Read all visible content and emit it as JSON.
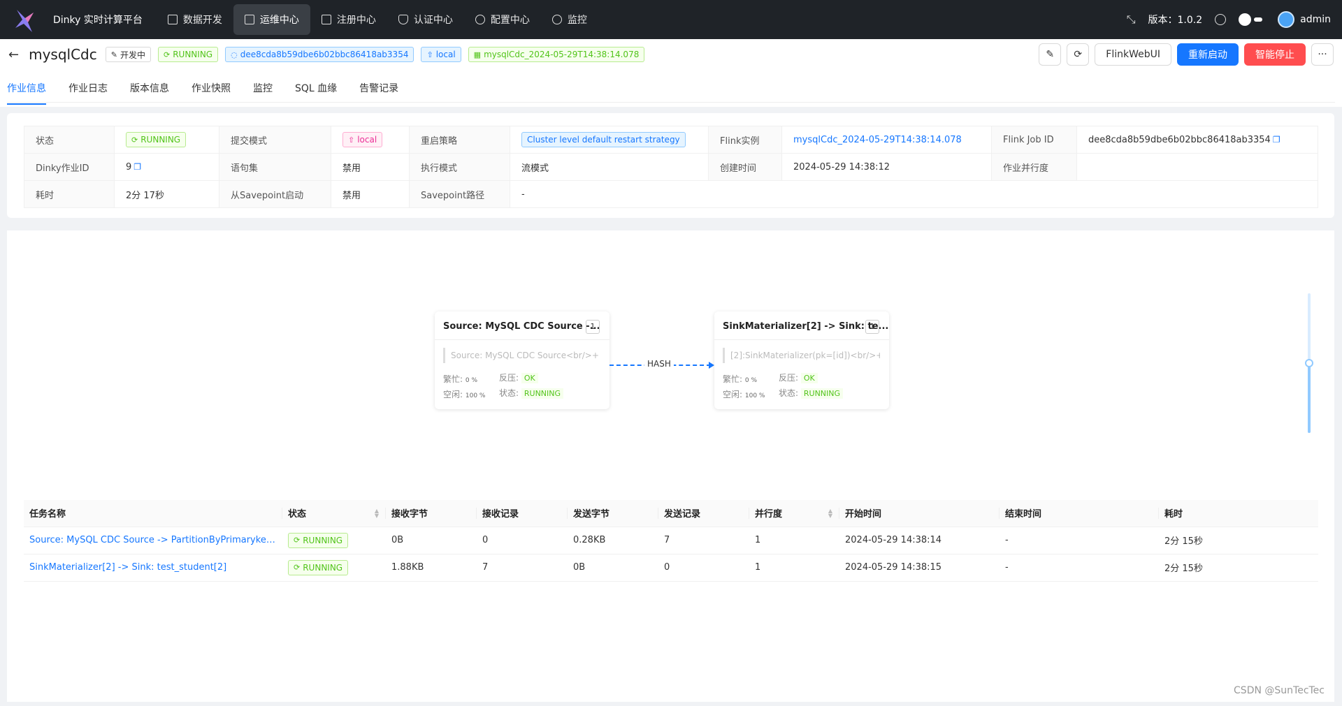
{
  "nav": {
    "brand": "Dinky 实时计算平台",
    "items": [
      "数据开发",
      "运维中心",
      "注册中心",
      "认证中心",
      "配置中心",
      "监控"
    ],
    "version": "版本：1.0.2",
    "user": "admin"
  },
  "header": {
    "job_name": "mysqlCdc",
    "dev_tag": "开发中",
    "status_tag": "RUNNING",
    "job_id_tag": "dee8cda8b59dbe6b02bbc86418ab3354",
    "env_tag": "local",
    "instance_tag": "mysqlCdc_2024-05-29T14:38:14.078",
    "btn_flinkweb": "FlinkWebUI",
    "btn_restart": "重新启动",
    "btn_stop": "智能停止",
    "btn_more": "···"
  },
  "tabs": [
    "作业信息",
    "作业日志",
    "版本信息",
    "作业快照",
    "监控",
    "SQL 血缘",
    "告警记录"
  ],
  "info": {
    "l_status": "状态",
    "v_status": "RUNNING",
    "l_submit": "提交模式",
    "v_submit": "local",
    "l_restart": "重启策略",
    "v_restart": "Cluster level default restart strategy",
    "l_instance": "Flink实例",
    "v_instance": "mysqlCdc_2024-05-29T14:38:14.078",
    "l_jobid": "Flink Job ID",
    "v_jobid": "dee8cda8b59dbe6b02bbc86418ab3354",
    "l_dinkyid": "Dinky作业ID",
    "v_dinkyid": "9",
    "l_stmt": "语句集",
    "v_stmt": "禁用",
    "l_exec": "执行模式",
    "v_exec": "流模式",
    "l_created": "创建时间",
    "v_created": "2024-05-29 14:38:12",
    "l_parallel": "作业并行度",
    "v_parallel": "",
    "l_duration": "耗时",
    "v_duration": "2分 17秒",
    "l_fromsp": "从Savepoint启动",
    "v_fromsp": "禁用",
    "l_sppath": "Savepoint路径",
    "v_sppath": "-"
  },
  "graph": {
    "nodes": [
      {
        "title": "Source: MySQL CDC Source -...",
        "parallelism": "1",
        "desc": "Source: MySQL CDC Source<br/>+",
        "busy_label": "繁忙:",
        "busy": "0 %",
        "idle_label": "空闲:",
        "idle": "100 %",
        "bp_label": "反压:",
        "bp": "OK",
        "state_label": "状态:",
        "state": "RUNNING"
      },
      {
        "title": "SinkMaterializer[2] -> Sink: te...",
        "parallelism": "1",
        "desc": "[2]:SinkMaterializer(pk=[id])<br/>+",
        "busy_label": "繁忙:",
        "busy": "0 %",
        "idle_label": "空闲:",
        "idle": "100 %",
        "bp_label": "反压:",
        "bp": "OK",
        "state_label": "状态:",
        "state": "RUNNING"
      }
    ],
    "edge_label": "HASH"
  },
  "table": {
    "headers": [
      "任务名称",
      "状态",
      "接收字节",
      "接收记录",
      "发送字节",
      "发送记录",
      "并行度",
      "开始时间",
      "结束时间",
      "耗时"
    ],
    "rows": [
      [
        "Source: MySQL CDC Source -> PartitionByPrimarykey -...",
        "RUNNING",
        "0B",
        "0",
        "0.28KB",
        "7",
        "1",
        "2024-05-29 14:38:14",
        "-",
        "2分 15秒"
      ],
      [
        "SinkMaterializer[2] -> Sink: test_student[2]",
        "RUNNING",
        "1.88KB",
        "7",
        "0B",
        "0",
        "1",
        "2024-05-29 14:38:15",
        "-",
        "2分 15秒"
      ]
    ]
  },
  "watermark": "CSDN @SunTecTec"
}
